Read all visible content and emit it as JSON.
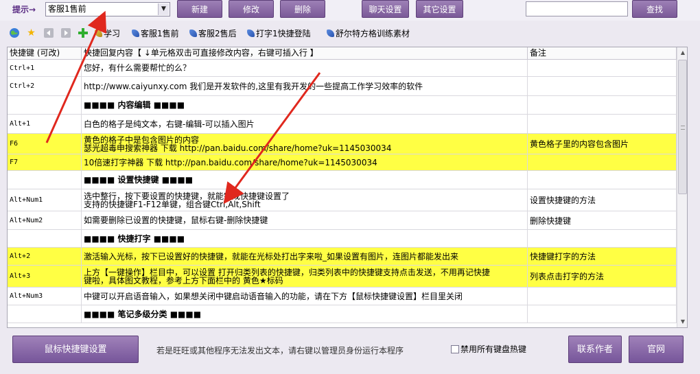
{
  "toolbar": {
    "hint_label": "提示→",
    "category_select_value": "客服1售前",
    "new_label": "新建",
    "edit_label": "修改",
    "delete_label": "删除",
    "chat_settings_label": "聊天设置",
    "other_settings_label": "其它设置",
    "search_value": "",
    "search_label": "查找"
  },
  "tree": {
    "items": [
      {
        "label": "学习",
        "icon": "folder-icon"
      },
      {
        "label": "客服1售前",
        "icon": "leaf-icon"
      },
      {
        "label": "客服2售后",
        "icon": "leaf-icon"
      },
      {
        "label": "打字1快捷登陆",
        "icon": "leaf-icon"
      },
      {
        "label": "舒尔特方格训练素材",
        "icon": "leaf-icon"
      }
    ]
  },
  "grid": {
    "headers": {
      "key": "快捷键 (可改)",
      "content": "快捷回复内容【 ↓单元格双击可直接修改内容，右键可插入行 】",
      "note": "备注"
    },
    "rows": [
      {
        "key": "Ctrl+1",
        "content": [
          "您好，有什么需要帮忙的么？"
        ],
        "note": "",
        "yellow": false
      },
      {
        "key": "Ctrl+2",
        "content": [
          "http://www.caiyunxy.com  我们是开发软件的,这里有我开发的一些提高工作学习效率的软件"
        ],
        "note": "",
        "yellow": false
      },
      {
        "key": "",
        "content": [
          "■■■■ 内容编辑 ■■■■"
        ],
        "note": "",
        "yellow": false,
        "heading": true
      },
      {
        "key": "Alt+1",
        "content": [
          "白色的格子是纯文本，右键-编辑-可以插入图片"
        ],
        "note": "",
        "yellow": false
      },
      {
        "key": "F6",
        "content": [
          "黄色的格子中是包含图片的内容",
          "瑟光超毒申搜索神器 下载 http://pan.baidu.com/share/home?uk=1145030034"
        ],
        "note": "黄色格子里的内容包含图片",
        "yellow": true
      },
      {
        "key": "F7",
        "content": [
          "10倍速打字神器 下载 http://pan.baidu.com/share/home?uk=1145030034"
        ],
        "note": "",
        "yellow": true
      },
      {
        "key": "",
        "content": [
          "■■■■ 设置快捷键 ■■■■"
        ],
        "note": "",
        "yellow": false,
        "heading": true
      },
      {
        "key": "Alt+Num1",
        "content": [
          "选中整行，按下要设置的快捷键，就能完成快捷键设置了",
          "支持的快捷键F1-F12单键，组合键Ctrl,Alt,Shift"
        ],
        "note": "设置快捷键的方法",
        "yellow": false
      },
      {
        "key": "Alt+Num2",
        "content": [
          "如需要删除已设置的快捷键，鼠标右键-删除快捷键"
        ],
        "note": "删除快捷键",
        "yellow": false
      },
      {
        "key": "",
        "content": [
          "■■■■ 快捷打字 ■■■■"
        ],
        "note": "",
        "yellow": false,
        "heading": true
      },
      {
        "key": "Alt+2",
        "content": [
          "激活输入光标，按下已设置好的快捷键，就能在光标处打出字来啦_如果设置有图片，连图片都能发出来"
        ],
        "note": "快捷键打字的方法",
        "yellow": true
      },
      {
        "key": "Alt+3",
        "content": [
          "上方【一键操作】栏目中，可以设置 打开归类列表的快捷键，归类列表中的快捷键支持点击发送，不用再记快捷",
          "键啦，具体图文教程，参考上方下面栏中的 黄色★标码"
        ],
        "note": "列表点击打字的方法",
        "yellow": true
      },
      {
        "key": "Alt+Num3",
        "content": [
          "中键可以开启语音输入，如果想关闭中键启动语音输入的功能，请在下方【鼠标快捷键设置】栏目里关闭"
        ],
        "note": "",
        "yellow": false
      },
      {
        "key": "",
        "content": [
          "■■■■ 笔记多级分类 ■■■■"
        ],
        "note": "",
        "yellow": false,
        "heading": true
      }
    ]
  },
  "bottom": {
    "mouse_shortcut_label": "鼠标快捷键设置",
    "notice": "若是旺旺或其他程序无法发出文本，请右键以管理员身份运行本程序",
    "disable_hotkeys_label": "禁用所有键盘热键",
    "disable_hotkeys_checked": false,
    "contact_author_label": "联系作者",
    "website_label": "官网"
  },
  "colors": {
    "accent_purple": "#7b5a98",
    "row_highlight_yellow": "#ffff44",
    "annotation_arrow_red": "#e0281e"
  }
}
